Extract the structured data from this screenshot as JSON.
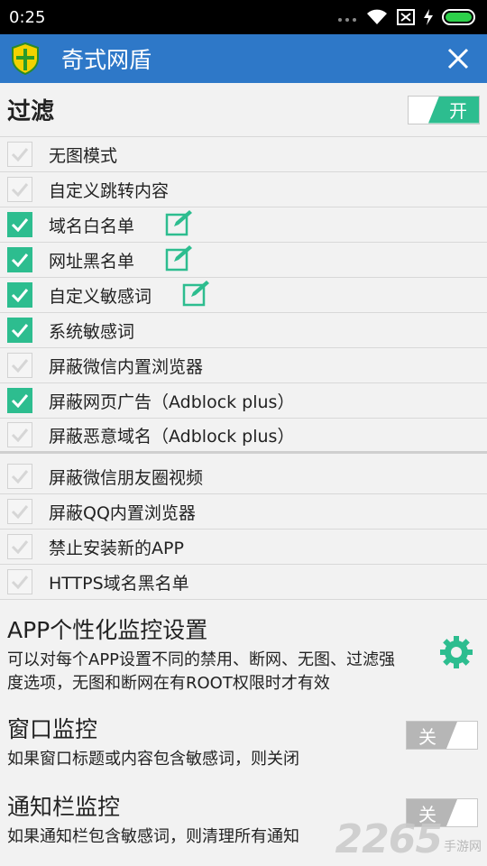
{
  "status": {
    "time": "0:25"
  },
  "app": {
    "title": "奇式网盾"
  },
  "filter": {
    "title": "过滤",
    "toggle_label": "开",
    "items": [
      {
        "label": "无图模式",
        "checked": false,
        "editable": false
      },
      {
        "label": "自定义跳转内容",
        "checked": false,
        "editable": false
      },
      {
        "label": "域名白名单",
        "checked": true,
        "editable": true
      },
      {
        "label": "网址黑名单",
        "checked": true,
        "editable": true
      },
      {
        "label": "自定义敏感词",
        "checked": true,
        "editable": true
      },
      {
        "label": "系统敏感词",
        "checked": true,
        "editable": false
      },
      {
        "label": "屏蔽微信内置浏览器",
        "checked": false,
        "editable": false
      },
      {
        "label": "屏蔽网页广告（Adblock plus）",
        "checked": true,
        "editable": false
      },
      {
        "label": "屏蔽恶意域名（Adblock plus）",
        "checked": false,
        "editable": false
      },
      {
        "label": "屏蔽微信朋友圈视频",
        "checked": false,
        "editable": false
      },
      {
        "label": "屏蔽QQ内置浏览器",
        "checked": false,
        "editable": false
      },
      {
        "label": "禁止安装新的APP",
        "checked": false,
        "editable": false
      },
      {
        "label": "HTTPS域名黑名单",
        "checked": false,
        "editable": false
      }
    ]
  },
  "app_monitor": {
    "title": "APP个性化监控设置",
    "desc": "可以对每个APP设置不同的禁用、断网、无图、过滤强度选项，无图和断网在有ROOT权限时才有效"
  },
  "window_monitor": {
    "title": "窗口监控",
    "desc": "如果窗口标题或内容包含敏感词，则关闭",
    "toggle_label": "关"
  },
  "notify_monitor": {
    "title": "通知栏监控",
    "desc": "如果通知栏包含敏感词，则清理所有通知",
    "toggle_label": "关"
  },
  "watermark": {
    "number": "2265",
    "text": "手游网"
  },
  "colors": {
    "accent": "#2dbd8f",
    "titlebar": "#2e78c8"
  }
}
